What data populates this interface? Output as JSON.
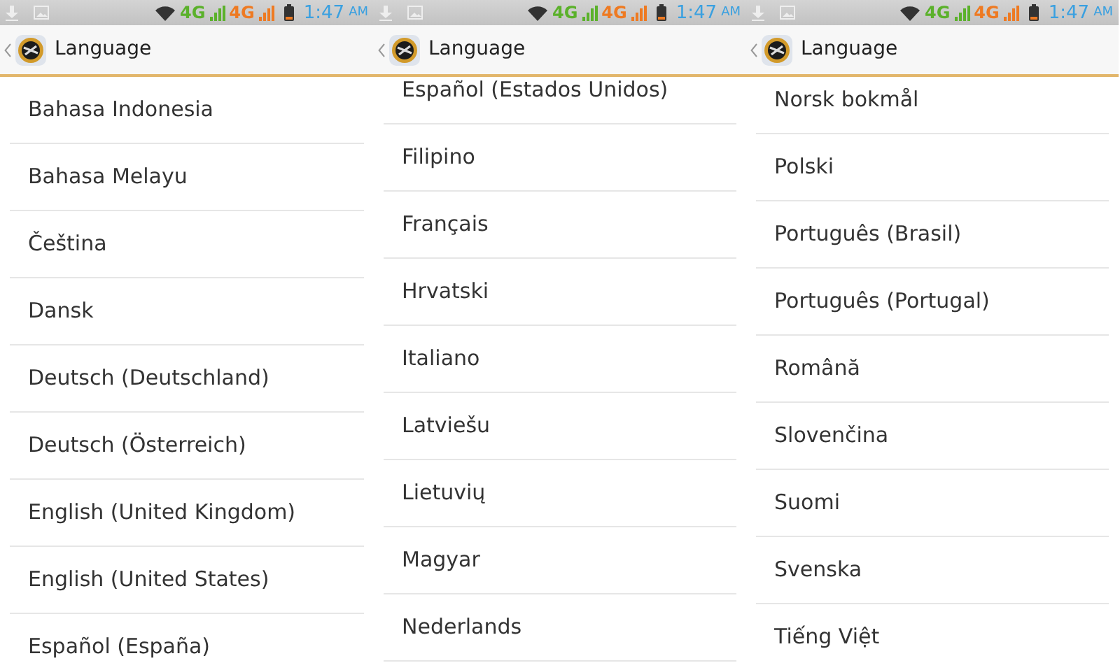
{
  "screens": [
    {
      "status_bar": {
        "network_1": "4G",
        "network_2": "4G",
        "time": "1:47",
        "meridiem": "AM"
      },
      "title": "Language",
      "items": [
        "Bahasa Indonesia",
        "Bahasa Melayu",
        "Čeština",
        "Dansk",
        "Deutsch (Deutschland)",
        "Deutsch (Österreich)",
        "English (United Kingdom)",
        "English (United States)",
        "Español (España)"
      ]
    },
    {
      "status_bar": {
        "network_1": "4G",
        "network_2": "4G",
        "time": "1:47",
        "meridiem": "AM"
      },
      "title": "Language",
      "items": [
        "Español (Estados Unidos)",
        "Filipino",
        "Français",
        "Hrvatski",
        "Italiano",
        "Latviešu",
        "Lietuvių",
        "Magyar",
        "Nederlands"
      ]
    },
    {
      "status_bar": {
        "network_1": "4G",
        "network_2": "4G",
        "time": "1:47",
        "meridiem": "AM"
      },
      "title": "Language",
      "items": [
        "Norsk bokmål",
        "Polski",
        "Português (Brasil)",
        "Português (Portugal)",
        "Română",
        "Slovenčina",
        "Suomi",
        "Svenska",
        "Tiếng Việt"
      ]
    }
  ]
}
